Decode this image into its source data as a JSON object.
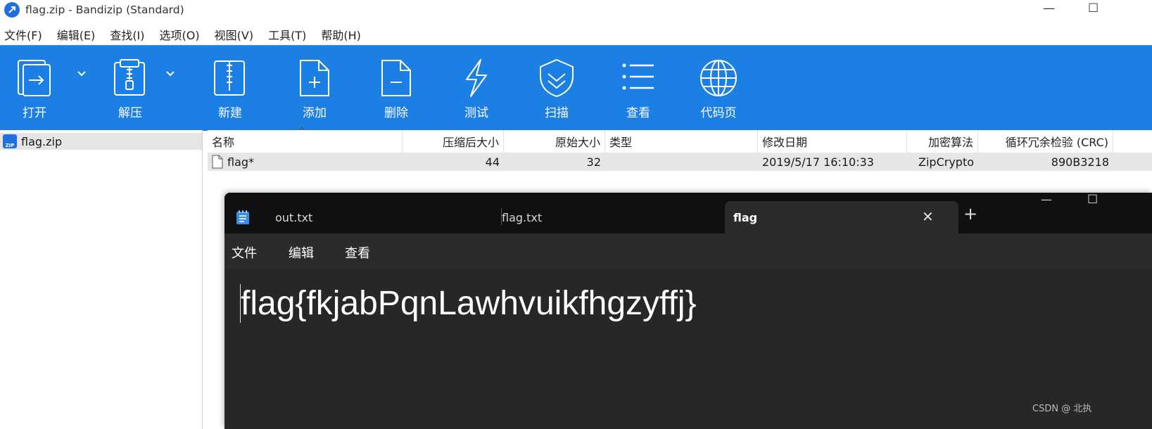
{
  "window": {
    "title": "flag.zip - Bandizip (Standard)"
  },
  "menu": [
    "文件(F)",
    "编辑(E)",
    "查找(I)",
    "选项(O)",
    "视图(V)",
    "工具(T)",
    "帮助(H)"
  ],
  "toolbar": {
    "open": "打开",
    "extract": "解压",
    "new": "新建",
    "add": "添加",
    "delete": "删除",
    "test": "测试",
    "scan": "扫描",
    "view": "查看",
    "codepage": "代码页"
  },
  "tree": {
    "archive": "flag.zip"
  },
  "table": {
    "headers": [
      "名称",
      "压缩后大小",
      "原始大小",
      "类型",
      "修改日期",
      "加密算法",
      "循环冗余检验 (CRC)"
    ],
    "rows": [
      {
        "name": "flag*",
        "packed": "44",
        "size": "32",
        "type": "",
        "modified": "2019/5/17 16:10:33",
        "enc": "ZipCrypto",
        "crc": "890B3218"
      }
    ]
  },
  "notepad": {
    "tabs": [
      "out.txt",
      "flag.txt",
      "flag"
    ],
    "active_tab": "flag",
    "menu": [
      "文件",
      "编辑",
      "查看"
    ],
    "content": "flag{fkjabPqnLawhvuikfhgzyffj}"
  },
  "watermark": "CSDN @ 北执"
}
